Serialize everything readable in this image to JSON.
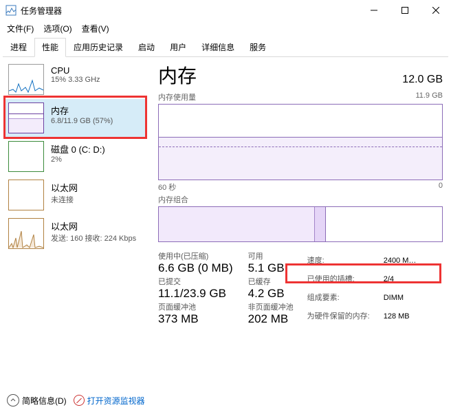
{
  "window": {
    "title": "任务管理器"
  },
  "menus": {
    "file": "文件(F)",
    "options": "选项(O)",
    "view": "查看(V)"
  },
  "tabs": [
    "进程",
    "性能",
    "应用历史记录",
    "启动",
    "用户",
    "详细信息",
    "服务"
  ],
  "active_tab": 1,
  "sidebar": [
    {
      "title": "CPU",
      "sub": "15% 3.33 GHz",
      "type": "cpu"
    },
    {
      "title": "内存",
      "sub": "6.8/11.9 GB (57%)",
      "type": "mem",
      "selected": true
    },
    {
      "title": "磁盘 0 (C: D:)",
      "sub": "2%",
      "type": "disk"
    },
    {
      "title": "以太网",
      "sub": "未连接",
      "type": "eth"
    },
    {
      "title": "以太网",
      "sub": "发送: 160 接收: 224 Kbps",
      "type": "eth2"
    }
  ],
  "main": {
    "title": "内存",
    "total": "12.0 GB",
    "usage_label": "内存使用量",
    "usage_max": "11.9 GB",
    "x_left": "60 秒",
    "x_right": "0",
    "composition_label": "内存组合",
    "stats": {
      "in_use_label": "使用中(已压缩)",
      "in_use_value": "6.6 GB (0 MB)",
      "available_label": "可用",
      "available_value": "5.1 GB",
      "committed_label": "已提交",
      "committed_value": "11.1/23.9 GB",
      "cached_label": "已缓存",
      "cached_value": "4.2 GB",
      "paged_label": "页面缓冲池",
      "paged_value": "373 MB",
      "nonpaged_label": "非页面缓冲池",
      "nonpaged_value": "202 MB"
    },
    "details": {
      "speed_label": "速度:",
      "speed_value": "2400 M…",
      "slots_label": "已使用的插槽:",
      "slots_value": "2/4",
      "form_label": "组成要素:",
      "form_value": "DIMM",
      "reserved_label": "为硬件保留的内存:",
      "reserved_value": "128 MB"
    }
  },
  "footer": {
    "fewer": "简略信息(D)",
    "resmon": "打开资源监视器"
  }
}
